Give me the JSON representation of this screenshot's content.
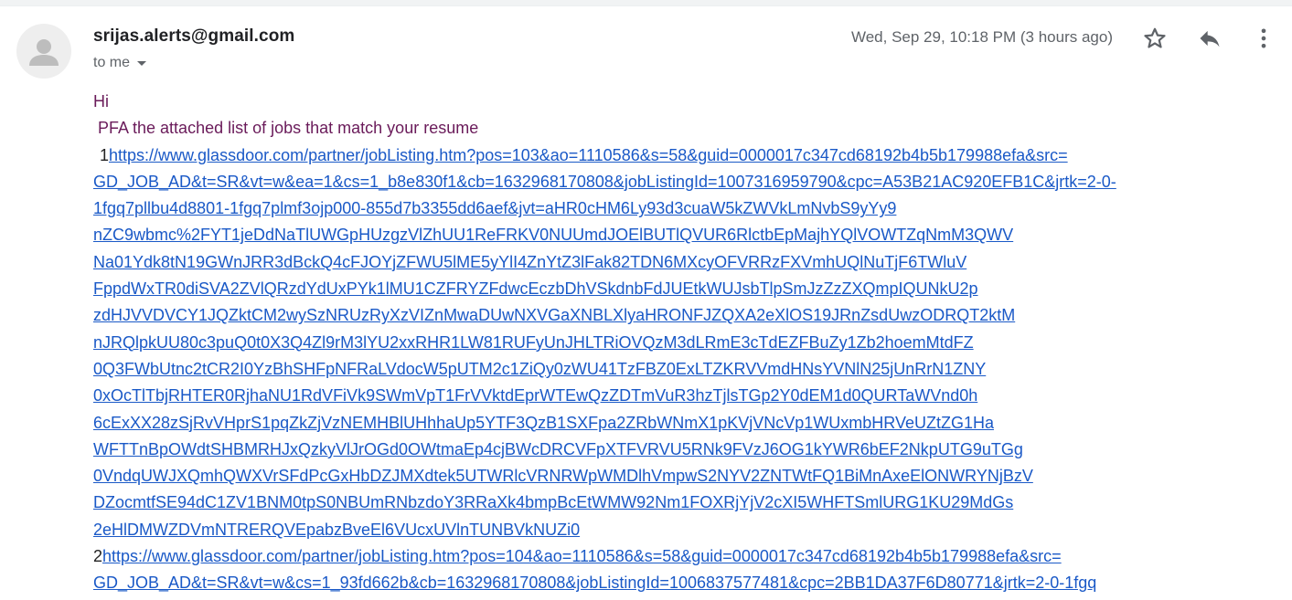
{
  "email": {
    "sender": "srijas.alerts@gmail.com",
    "recipient_label": "to me",
    "date": "Wed, Sep 29, 10:18 PM (3 hours ago)",
    "icons": {
      "avatar": "person-icon",
      "star": "star-icon",
      "reply": "reply-icon",
      "more": "more-vert-icon",
      "recipient_dropdown": "chevron-down-icon"
    },
    "body": {
      "greeting": "Hi",
      "intro": " PFA the attached list of jobs that match your resume",
      "jobs": [
        {
          "number": "1",
          "lines": [
            "https://www.glassdoor.com/partner/jobListing.htm?pos=103&ao=1110586&s=58&guid=0000017c347cd68192b4b5b179988efa&src=",
            "GD_JOB_AD&t=SR&vt=w&ea=1&cs=1_b8e830f1&cb=1632968170808&jobListingId=1007316959790&cpc=A53B21AC920EFB1C&jrtk=2-0-",
            "1fgq7pllbu4d8801-1fgq7plmf3ojp000-855d7b3355dd6aef&jvt=aHR0cHM6Ly93d3cuaW5kZWVkLmNvbS9yYy9",
            "nZC9wbmc%2FYT1jeDdNaTlUWGpHUzgzVlZhUU1ReFRKV0NUUmdJOElBUTlQVUR6RlctbEpMajhYQlVOWTZqNmM3QWV",
            "Na01Ydk8tN19GWnJRR3dBckQ4cFJOYjZFWU5lME5yYlI4ZnYtZ3lFak82TDN6MXcyOFVRRzFXVmhUQlNuTjF6TWluV",
            "FppdWxTR0diSVA2ZVlQRzdYdUxPYk1lMU1CZFRYZFdwcEczbDhVSkdnbFdJUEtkWUJsbTlpSmJzZzZXQmpIQUNkU2p",
            "zdHJVVDVCY1JQZktCM2wySzNRUzRyXzVIZnMwaDUwNXVGaXNBLXlyaHRONFJZQXA2eXlOS19JRnZsdUwzODRQT2ktM",
            "nJRQlpkUU80c3puQ0t0X3Q4Zl9rM3lYU2xxRHR1LW81RUFyUnJHLTRiOVQzM3dLRmE3cTdEZFBuZy1Zb2hoemMtdFZ",
            "0Q3FWbUtnc2tCR2I0YzBhSHFpNFRaLVdocW5pUTM2c1ZiQy0zWU41TzFBZ0ExLTZKRVVmdHNsYVNlN25jUnRrN1ZNY",
            "0xOcTlTbjRHTER0RjhaNU1RdVFiVk9SWmVpT1FrVVktdEprWTEwQzZDTmVuR3hzTjlsTGp2Y0dEM1d0QURTaWVnd0h",
            "6cExXX28zSjRvVHprS1pqZkZjVzNEMHBlUHhhaUp5YTF3QzB1SXFpa2ZRbWNmX1pKVjVNcVp1WUxmbHRVeUZtZG1Ha",
            "WFTTnBpOWdtSHBMRHJxQzkyVlJrOGd0OWtmaEp4cjBWcDRCVFpXTFVRVU5RNk9FVzJ6OG1kYWR6bEF2NkpUTG9uTGg",
            "0VndqUWJXQmhQWXVrSFdPcGxHbDZJMXdtek5UTWRlcVRNRWpWMDlhVmpwS2NYV2ZNTWtFQ1BiMnAxeElONWRYNjBzV",
            "DZocmtfSE94dC1ZV1BNM0tpS0NBUmRNbzdoY3RRaXk4bmpBcEtWMW92Nm1FOXRjYjV2cXI5WHFTSmlURG1KU29MdGs",
            "2eHlDMWZDVmNTRERQVEpabzBveEl6VUcxUVlnTUNBVkNUZi0"
          ]
        },
        {
          "number": "2",
          "lines": [
            "https://www.glassdoor.com/partner/jobListing.htm?pos=104&ao=1110586&s=58&guid=0000017c347cd68192b4b5b179988efa&src=",
            "GD_JOB_AD&t=SR&vt=w&cs=1_93fd662b&cb=1632968170808&jobListingId=1006837577481&cpc=2BB1DA37F6D80771&jrtk=2-0-1fgq"
          ]
        }
      ]
    }
  }
}
